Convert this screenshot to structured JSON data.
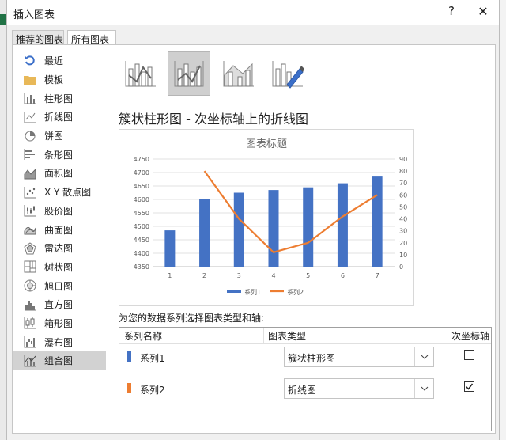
{
  "window": {
    "title": "插入图表",
    "help": "?",
    "close": "✕"
  },
  "tabs": [
    {
      "label": "推荐的图表"
    },
    {
      "label": "所有图表"
    }
  ],
  "sidebar": {
    "items": [
      {
        "label": "最近",
        "icon": "recent-icon"
      },
      {
        "label": "模板",
        "icon": "folder-icon"
      },
      {
        "label": "柱形图",
        "icon": "column-chart-icon"
      },
      {
        "label": "折线图",
        "icon": "line-chart-icon"
      },
      {
        "label": "饼图",
        "icon": "pie-chart-icon"
      },
      {
        "label": "条形图",
        "icon": "bar-chart-icon"
      },
      {
        "label": "面积图",
        "icon": "area-chart-icon"
      },
      {
        "label": "X Y 散点图",
        "icon": "scatter-chart-icon"
      },
      {
        "label": "股价图",
        "icon": "stock-chart-icon"
      },
      {
        "label": "曲面图",
        "icon": "surface-chart-icon"
      },
      {
        "label": "雷达图",
        "icon": "radar-chart-icon"
      },
      {
        "label": "树状图",
        "icon": "treemap-chart-icon"
      },
      {
        "label": "旭日图",
        "icon": "sunburst-chart-icon"
      },
      {
        "label": "直方图",
        "icon": "histogram-chart-icon"
      },
      {
        "label": "箱形图",
        "icon": "boxplot-chart-icon"
      },
      {
        "label": "瀑布图",
        "icon": "waterfall-chart-icon"
      },
      {
        "label": "组合图",
        "icon": "combo-chart-icon"
      }
    ],
    "selected_index": 16
  },
  "subtypes": [
    "clustered-column-line-icon",
    "clustered-column-line-secondary-icon",
    "stacked-area-column-icon",
    "custom-combo-icon"
  ],
  "subtype_selected": 1,
  "chart_heading": "簇状柱形图 - 次坐标轴上的折线图",
  "chart_data": {
    "type": "bar",
    "title": "图表标题",
    "categories": [
      "1",
      "2",
      "3",
      "4",
      "5",
      "6",
      "7"
    ],
    "series": [
      {
        "name": "系列1",
        "chart": "bar",
        "axis": "primary",
        "color": "#4472C4",
        "values": [
          4485,
          4600,
          4625,
          4635,
          4645,
          4660,
          4685
        ]
      },
      {
        "name": "系列2",
        "chart": "line",
        "axis": "secondary",
        "color": "#ED7D31",
        "values": [
          null,
          80,
          40,
          12,
          20,
          42,
          60
        ]
      }
    ],
    "y_primary": {
      "min": 4350,
      "max": 4750,
      "ticks": [
        "4750",
        "4700",
        "4650",
        "4600",
        "4550",
        "4500",
        "4450",
        "4400",
        "4350"
      ]
    },
    "y_secondary": {
      "min": 0,
      "max": 90,
      "ticks": [
        "90",
        "80",
        "70",
        "60",
        "50",
        "40",
        "30",
        "20",
        "10",
        "0"
      ]
    },
    "legend": "bottom",
    "grid": true
  },
  "series_prompt": "为您的数据系列选择图表类型和轴:",
  "series_table": {
    "headers": {
      "name": "系列名称",
      "type": "图表类型",
      "axis": "次坐标轴"
    },
    "rows": [
      {
        "name": "系列1",
        "color": "#4472C4",
        "type": "簇状柱形图",
        "secondary": false
      },
      {
        "name": "系列2",
        "color": "#ED7D31",
        "type": "折线图",
        "secondary": true
      }
    ]
  }
}
